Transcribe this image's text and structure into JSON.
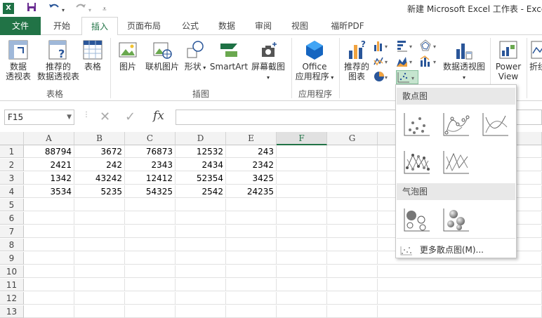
{
  "titlebar": {
    "title": "新建 Microsoft Excel 工作表 - Exce",
    "app_icon": "X"
  },
  "tabs": [
    {
      "label": "文件"
    },
    {
      "label": "开始"
    },
    {
      "label": "插入"
    },
    {
      "label": "页面布局"
    },
    {
      "label": "公式"
    },
    {
      "label": "数据"
    },
    {
      "label": "审阅"
    },
    {
      "label": "视图"
    },
    {
      "label": "福昕PDF"
    }
  ],
  "ribbon": {
    "pivot_table": {
      "line1": "数据",
      "line2": "透视表"
    },
    "recommended_pivot": {
      "line1": "推荐的",
      "line2": "数据透视表"
    },
    "table": "表格",
    "group_tables": "表格",
    "pictures": "图片",
    "online_pictures": "联机图片",
    "shapes": "形状",
    "smartart": "SmartArt",
    "screenshot": "屏幕截图",
    "group_illustrations": "插图",
    "office_apps": {
      "line1": "Office",
      "line2": "应用程序"
    },
    "group_apps": "应用程序",
    "recommended_charts": {
      "line1": "推荐的",
      "line2": "图表"
    },
    "pivot_chart": "数据透视图",
    "power_view": {
      "line1": "Power",
      "line2": "View"
    },
    "sparkline": "折线"
  },
  "formulabar": {
    "namebox": "F15",
    "fx": "fx"
  },
  "sheet": {
    "columns": [
      "A",
      "B",
      "C",
      "D",
      "E",
      "F",
      "G"
    ],
    "rows": [
      "1",
      "2",
      "3",
      "4",
      "5",
      "6",
      "7",
      "8",
      "9",
      "10",
      "11",
      "12",
      "13"
    ],
    "cells": [
      [
        "88794",
        "3672",
        "76873",
        "12532",
        "243"
      ],
      [
        "2421",
        "242",
        "2343",
        "2434",
        "2342"
      ],
      [
        "1342",
        "43242",
        "12412",
        "52354",
        "3425"
      ],
      [
        "3534",
        "5235",
        "54325",
        "2542",
        "24235"
      ]
    ]
  },
  "dropdown": {
    "scatter_header": "散点图",
    "bubble_header": "气泡图",
    "more_label": "更多散点图(M)..."
  },
  "colors": {
    "excel_green": "#217346",
    "selected_button": "#c6e5cf"
  }
}
